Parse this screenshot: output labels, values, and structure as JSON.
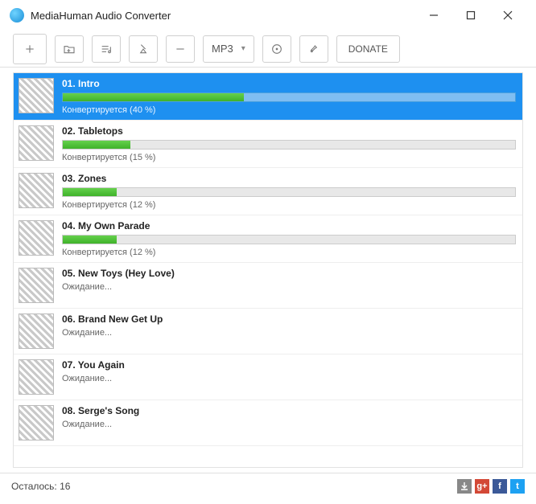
{
  "window": {
    "title": "MediaHuman Audio Converter"
  },
  "toolbar": {
    "format_label": "MP3",
    "donate_label": "DONATE"
  },
  "tracks": [
    {
      "num": "01",
      "title": "Intro",
      "progress": 40,
      "status": "Конвертируется (40 %)",
      "selected": true,
      "has_progress": true
    },
    {
      "num": "02",
      "title": "Tabletops",
      "progress": 15,
      "status": "Конвертируется (15 %)",
      "selected": false,
      "has_progress": true
    },
    {
      "num": "03",
      "title": "Zones",
      "progress": 12,
      "status": "Конвертируется (12 %)",
      "selected": false,
      "has_progress": true
    },
    {
      "num": "04",
      "title": "My Own Parade",
      "progress": 12,
      "status": "Конвертируется (12 %)",
      "selected": false,
      "has_progress": true
    },
    {
      "num": "05",
      "title": "New Toys (Hey Love)",
      "progress": 0,
      "status": "Ожидание...",
      "selected": false,
      "has_progress": false
    },
    {
      "num": "06",
      "title": "Brand New Get Up",
      "progress": 0,
      "status": "Ожидание...",
      "selected": false,
      "has_progress": false
    },
    {
      "num": "07",
      "title": "You Again",
      "progress": 0,
      "status": "Ожидание...",
      "selected": false,
      "has_progress": false
    },
    {
      "num": "08",
      "title": "Serge's Song",
      "progress": 0,
      "status": "Ожидание...",
      "selected": false,
      "has_progress": false
    }
  ],
  "statusbar": {
    "remaining_label": "Осталось: 16"
  },
  "social": {
    "g": "g+",
    "f": "f",
    "t": "t"
  }
}
